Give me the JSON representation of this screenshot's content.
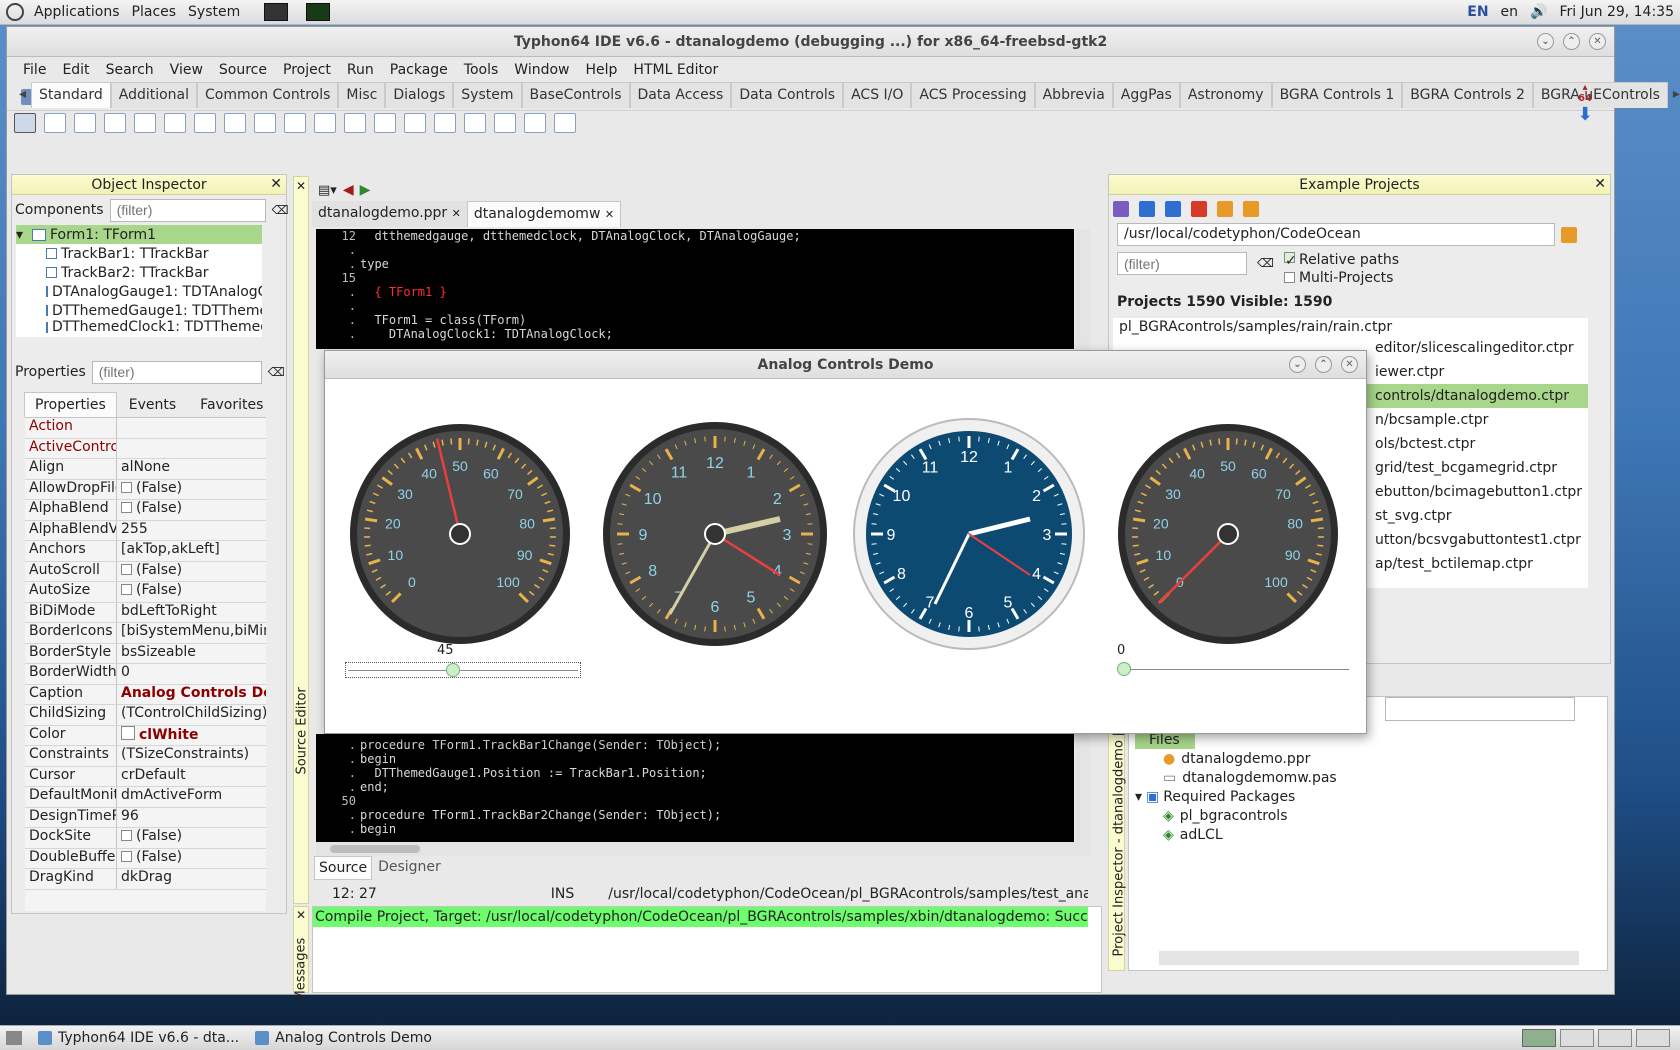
{
  "topbar": {
    "menus": [
      "Applications",
      "Places",
      "System"
    ],
    "lang": "EN",
    "locale": "en",
    "clock": "Fri Jun 29, 14:35"
  },
  "window": {
    "title": "Typhon64 IDE v6.6 - dtanalogdemo (debugging ...) for x86_64-freebsd-gtk2"
  },
  "menubar": [
    "File",
    "Edit",
    "Search",
    "View",
    "Source",
    "Project",
    "Run",
    "Package",
    "Tools",
    "Window",
    "Help",
    "HTML Editor"
  ],
  "palette_tabs": [
    "Standard",
    "Additional",
    "Common Controls",
    "Misc",
    "Dialogs",
    "System",
    "BaseControls",
    "Data Access",
    "Data Controls",
    "ACS I/O",
    "ACS Processing",
    "Abbrevia",
    "AggPas",
    "Astronomy",
    "BGRA Controls 1",
    "BGRA Controls 2",
    "BGRA uEControls"
  ],
  "object_inspector": {
    "title": "Object Inspector",
    "components_label": "Components",
    "filter_placeholder": "(filter)",
    "tree": [
      "Form1: TForm1",
      "TrackBar1: TTrackBar",
      "TrackBar2: TTrackBar",
      "DTAnalogGauge1: TDTAnalogGa",
      "DTThemedGauge1: TDTThemedG",
      "DTThemedClock1: TDTThemedC"
    ],
    "properties_label": "Properties",
    "tabs": [
      "Properties",
      "Events",
      "Favorites"
    ],
    "rows": [
      {
        "name": "Action",
        "value": ""
      },
      {
        "name": "ActiveControl",
        "value": ""
      },
      {
        "name": "Align",
        "value": "alNone"
      },
      {
        "name": "AllowDropFiles",
        "value": "(False)"
      },
      {
        "name": "AlphaBlend",
        "value": "(False)"
      },
      {
        "name": "AlphaBlendVal",
        "value": "255"
      },
      {
        "name": "Anchors",
        "value": "[akTop,akLeft]"
      },
      {
        "name": "AutoScroll",
        "value": "(False)"
      },
      {
        "name": "AutoSize",
        "value": "(False)"
      },
      {
        "name": "BiDiMode",
        "value": "bdLeftToRight"
      },
      {
        "name": "BorderIcons",
        "value": "[biSystemMenu,biMini"
      },
      {
        "name": "BorderStyle",
        "value": "bsSizeable"
      },
      {
        "name": "BorderWidth",
        "value": "0"
      },
      {
        "name": "Caption",
        "value": "Analog Controls De"
      },
      {
        "name": "ChildSizing",
        "value": "(TControlChildSizing)"
      },
      {
        "name": "Color",
        "value": "clWhite"
      },
      {
        "name": "Constraints",
        "value": "(TSizeConstraints)"
      },
      {
        "name": "Cursor",
        "value": "crDefault"
      },
      {
        "name": "DefaultMonito",
        "value": "dmActiveForm"
      },
      {
        "name": "DesignTimePP",
        "value": "96"
      },
      {
        "name": "DockSite",
        "value": "(False)"
      },
      {
        "name": "DoubleBuffere",
        "value": "(False)"
      },
      {
        "name": "DragKind",
        "value": "dkDrag"
      }
    ]
  },
  "editor": {
    "tabs": [
      "dtanalogdemo.ppr",
      "dtanalogdemomw"
    ],
    "lines_top": [
      {
        "n": "12",
        "t": "  dtthemedgauge, dtthemedclock, DTAnalogClock, DTAnalogGauge;"
      },
      {
        "n": ".",
        "t": ""
      },
      {
        "n": ".",
        "t": "type"
      },
      {
        "n": "15",
        "t": ""
      },
      {
        "n": ".",
        "t": "  { TForm1 }"
      },
      {
        "n": ".",
        "t": ""
      },
      {
        "n": ".",
        "t": "  TForm1 = class(TForm)"
      },
      {
        "n": ".",
        "t": "    DTAnalogClock1: TDTAnalogClock;"
      }
    ],
    "lines_bottom": [
      {
        "n": ".",
        "t": "procedure TForm1.TrackBar1Change(Sender: TObject);"
      },
      {
        "n": ".",
        "t": "begin"
      },
      {
        "n": ".",
        "t": "  DTThemedGauge1.Position := TrackBar1.Position;"
      },
      {
        "n": ".",
        "t": "end;"
      },
      {
        "n": "50",
        "t": ""
      },
      {
        "n": ".",
        "t": "procedure TForm1.TrackBar2Change(Sender: TObject);"
      },
      {
        "n": ".",
        "t": "begin"
      }
    ],
    "side_label": "Source Editor",
    "bottom_tabs": [
      "Source",
      "Designer"
    ],
    "status": {
      "pos": "12: 27",
      "mode": "INS",
      "path": "/usr/local/codetyphon/CodeOcean/pl_BGRAcontrols/samples/test_analog_..."
    }
  },
  "messages": {
    "label": "Messages",
    "line": "Compile Project, Target: /usr/local/codetyphon/CodeOcean/pl_BGRAcontrols/samples/xbin/dtanalogdemo: Success"
  },
  "example_projects": {
    "title": "Example Projects",
    "path": "/usr/local/codetyphon/CodeOcean",
    "filter_placeholder": "(filter)",
    "relative_paths": "Relative paths",
    "multi_projects": "Multi-Projects",
    "counts": "Projects 1590  Visible: 1590",
    "files": [
      "pl_BGRAcontrols/samples/rain/rain.ctpr",
      "editor/slicescalingeditor.ctpr",
      "iewer.ctpr",
      "controls/dtanalogdemo.ctpr",
      "n/bcsample.ctpr",
      "ols/bctest.ctpr",
      "grid/test_bcgamegrid.ctpr",
      "ebutton/bcimagebutton1.ctpr",
      "st_svg.ctpr",
      "utton/bcsvgabuttontest1.ctpr",
      "ap/test_bctilemap.ctpr"
    ]
  },
  "project_inspector": {
    "side_label": "Project Inspector - dtanalogdemo [D",
    "files_label": "Files",
    "files": [
      "dtanalogdemo.ppr",
      "dtanalogdemomw.pas"
    ],
    "required_label": "Required Packages",
    "packages": [
      "pl_bgracontrols",
      "adLCL"
    ]
  },
  "dialog": {
    "title": "Analog Controls Demo",
    "trackbar1_value": "45",
    "trackbar2_value": "0",
    "gauge1_value": 45,
    "gauge2_value": 0,
    "gauge_labels": [
      "0",
      "10",
      "20",
      "30",
      "40",
      "50",
      "60",
      "70",
      "80",
      "90",
      "100"
    ],
    "clock_numbers": [
      "12",
      "1",
      "2",
      "3",
      "4",
      "5",
      "6",
      "7",
      "8",
      "9",
      "10",
      "11"
    ]
  },
  "taskbar": {
    "items": [
      "Typhon64 IDE v6.6 - dta...",
      "Analog Controls Demo"
    ]
  },
  "colors": {
    "accent_green": "#6cfc6c",
    "selection_green": "#a8d68a",
    "panel_head": "#f2f2b5"
  }
}
